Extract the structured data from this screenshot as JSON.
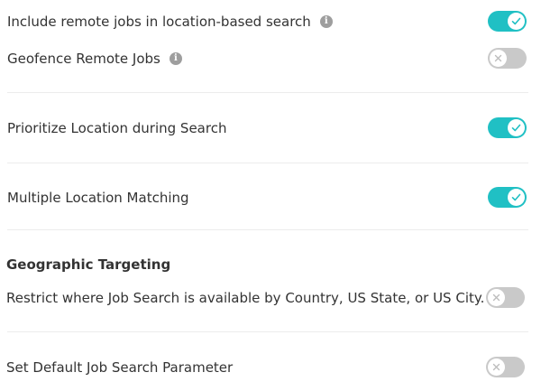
{
  "settings": [
    {
      "label": "Include remote jobs in location-based search",
      "has_info": true,
      "enabled": true
    },
    {
      "label": "Geofence Remote Jobs",
      "has_info": true,
      "enabled": false
    },
    {
      "label": "Prioritize Location during Search",
      "has_info": false,
      "enabled": true
    },
    {
      "label": "Multiple Location Matching",
      "has_info": false,
      "enabled": true
    }
  ],
  "geo": {
    "heading": "Geographic Targeting",
    "restrict_label": "Restrict where Job Search is available by Country, US State, or US City.",
    "restrict_enabled": false
  },
  "default_param": {
    "label": "Set Default Job Search Parameter",
    "enabled": false
  },
  "info_glyph": "i",
  "icons": {
    "info": "info-icon",
    "on": "check-icon",
    "off": "x-icon"
  },
  "colors": {
    "toggle_on": "#20c0c4",
    "toggle_off": "#c9c9c9",
    "info": "#9e9e9e"
  }
}
